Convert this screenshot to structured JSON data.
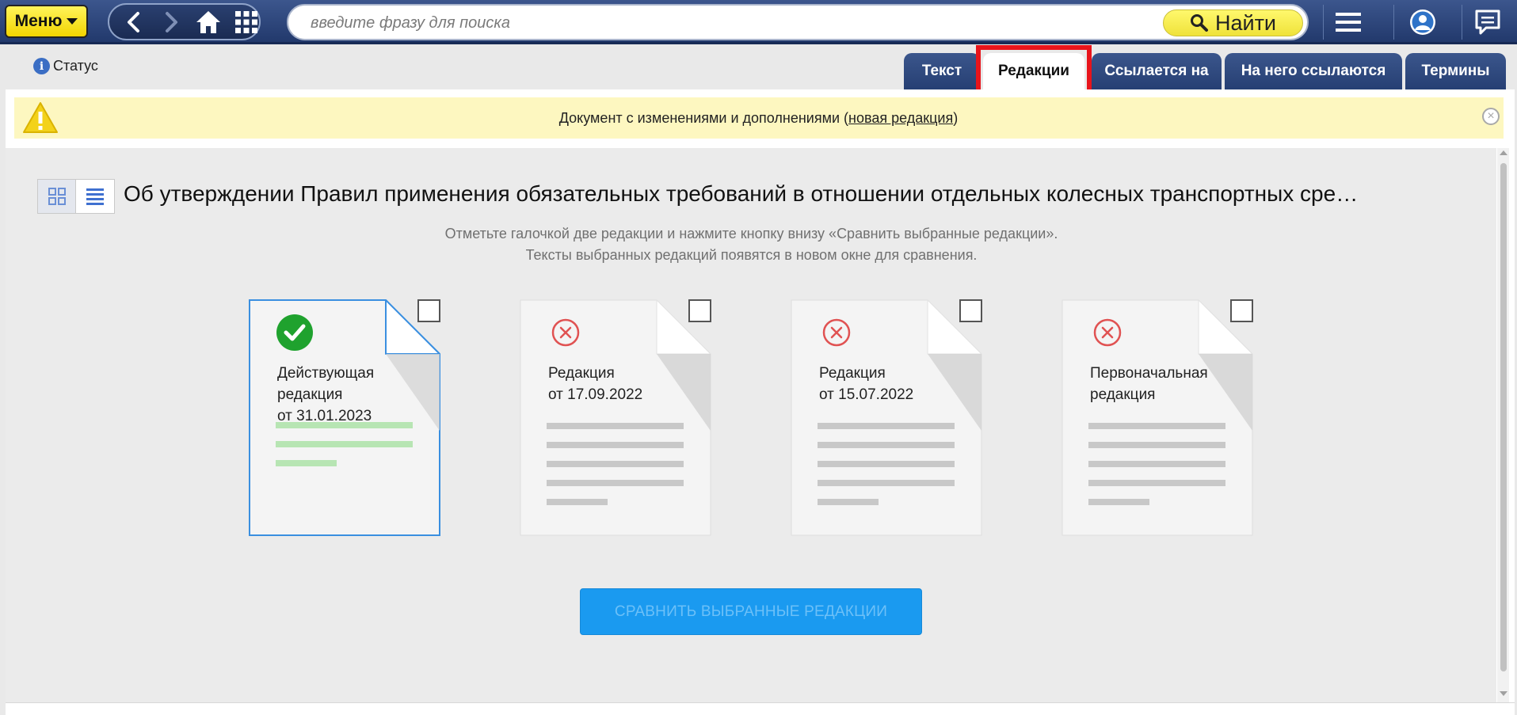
{
  "topbar": {
    "menu_label": "Меню",
    "search_placeholder": "введите фразу для поиска",
    "find_label": "Найти"
  },
  "status_label": "Статус",
  "tabs": [
    {
      "label": "Текст",
      "active": false
    },
    {
      "label": "Редакции",
      "active": true
    },
    {
      "label": "Ссылается на",
      "active": false
    },
    {
      "label": "На него ссылаются",
      "active": false
    },
    {
      "label": "Термины",
      "active": false
    }
  ],
  "warning": {
    "text_before": "Документ с изменениями и дополнениями (",
    "link": "новая редакция",
    "text_after": ")"
  },
  "document": {
    "title": "Об утверждении Правил применения обязательных требований в отношении отдельных колесных транспортных сре…",
    "hint_line1": "Отметьте галочкой две редакции и нажмите кнопку внизу «Сравнить выбранные редакции».",
    "hint_line2": "Тексты выбранных редакций появятся в новом окне для сравнения."
  },
  "editions": [
    {
      "label": "Действующая\nредакция\nот 31.01.2023",
      "status": "current",
      "checked": false
    },
    {
      "label": "Редакция\nот 17.09.2022",
      "status": "outdated",
      "checked": false
    },
    {
      "label": "Редакция\nот 15.07.2022",
      "status": "outdated",
      "checked": false
    },
    {
      "label": "Первоначальная\nредакция",
      "status": "outdated",
      "checked": false
    }
  ],
  "compare_button": "СРАВНИТЬ ВЫБРАННЫЕ РЕДАКЦИИ",
  "colors": {
    "topbar": "#2d4679",
    "menu_button": "#f6e41e",
    "current_accent": "#2aa82e",
    "outdated_accent": "#e05252",
    "compare_button": "#1a9af0",
    "tab_highlight": "#e8141b"
  },
  "icons": {
    "back": "chevron-left-icon",
    "forward": "chevron-right-icon",
    "home": "home-icon",
    "apps": "grid-icon",
    "search": "search-icon",
    "menu": "hamburger-icon",
    "profile": "user-icon",
    "chat": "chat-icon"
  }
}
